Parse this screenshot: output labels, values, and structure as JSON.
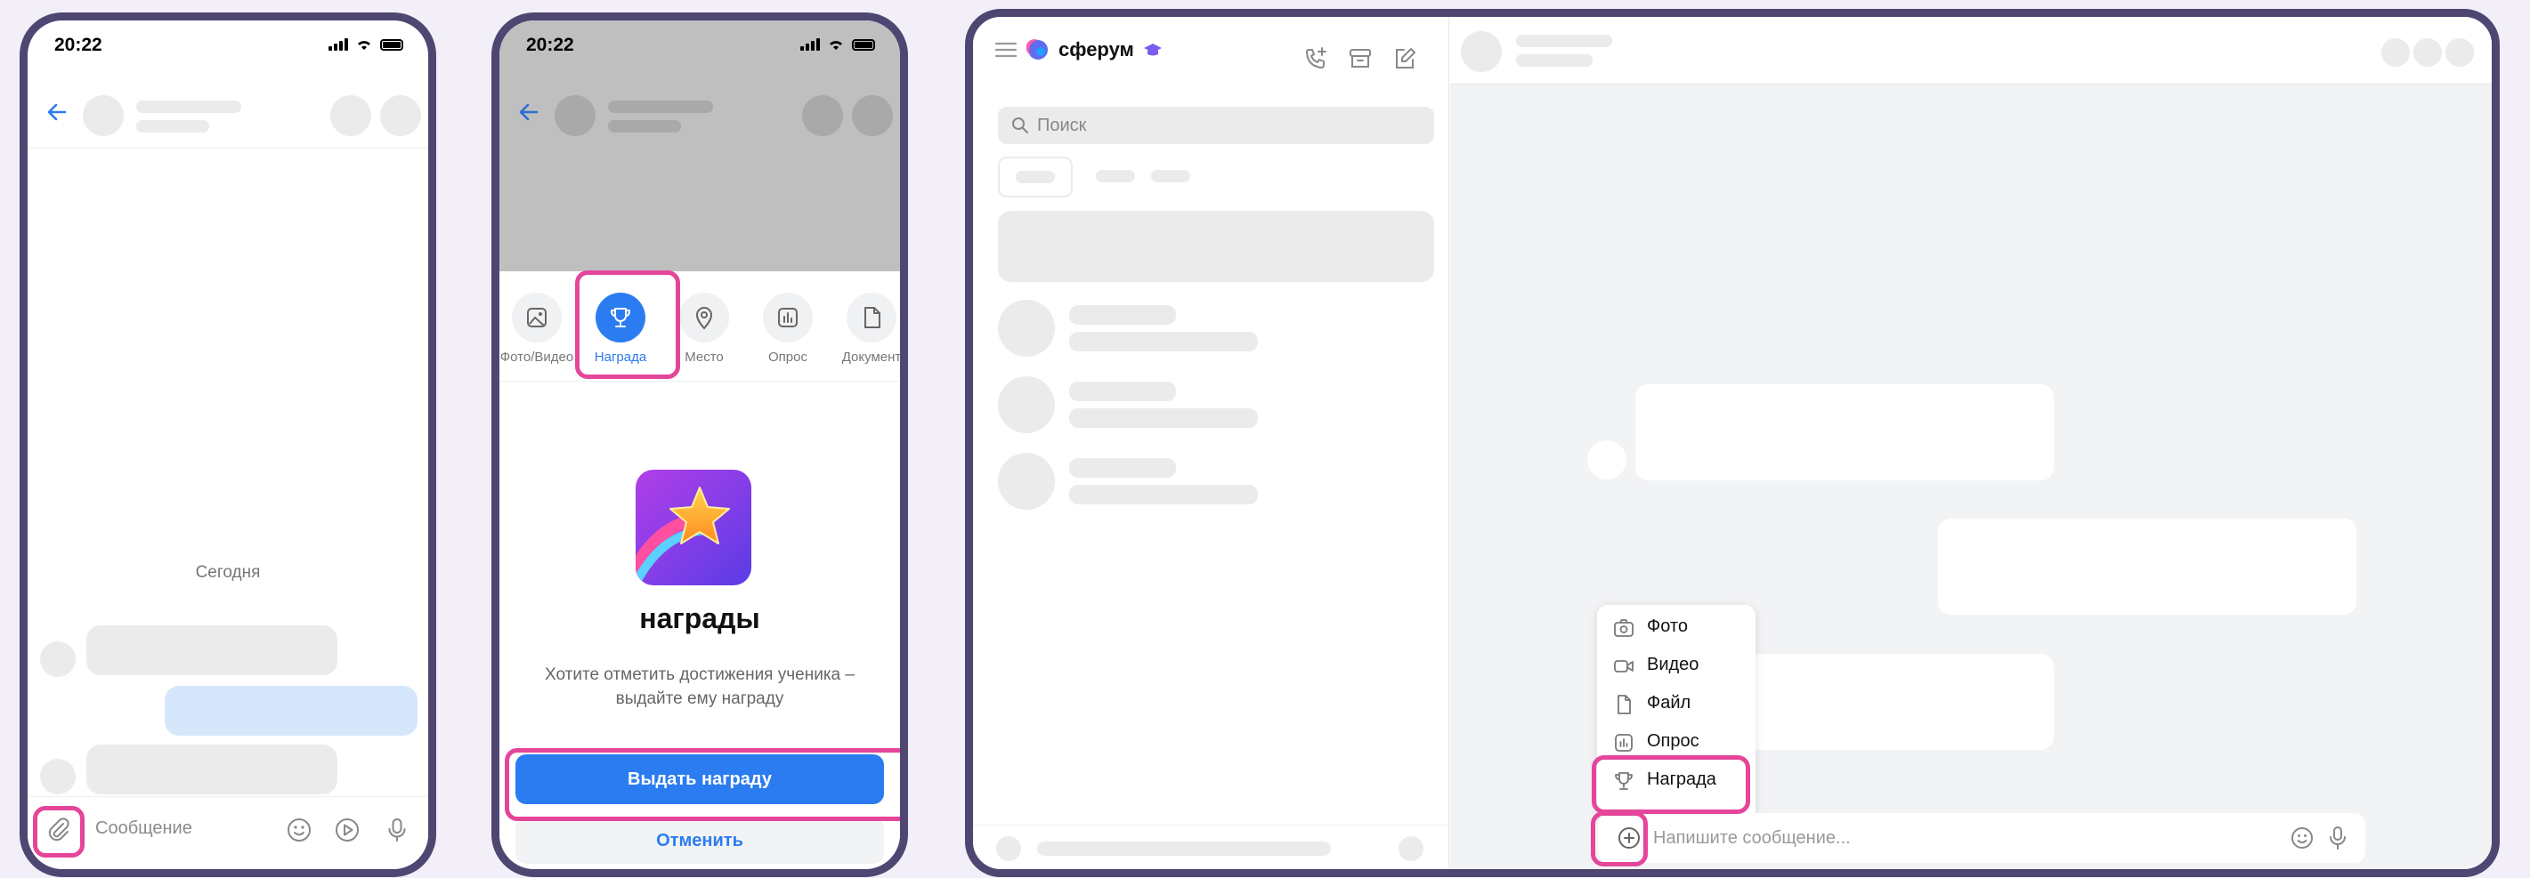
{
  "colors": {
    "frame": "#4f4672",
    "accent": "#2b7cf0",
    "highlight": "#e5459a",
    "background": "#f2eff8"
  },
  "phone1": {
    "time": "20:22",
    "date_divider": "Сегодня",
    "input_placeholder": "Сообщение",
    "icons": [
      "back-arrow-icon",
      "paperclip-icon",
      "emoji-icon",
      "play-icon",
      "microphone-icon"
    ]
  },
  "phone2": {
    "time": "20:22",
    "attach_items": [
      {
        "label": "Фото/Видео",
        "icon": "photo-icon"
      },
      {
        "label": "Награда",
        "icon": "trophy-icon",
        "selected": true
      },
      {
        "label": "Место",
        "icon": "location-icon"
      },
      {
        "label": "Опрос",
        "icon": "poll-icon"
      },
      {
        "label": "Документ",
        "icon": "document-icon"
      }
    ],
    "award_title": "награды",
    "award_description": "Хотите отметить достижения ученика – выдайте ему награду",
    "primary_button": "Выдать награду",
    "secondary_button": "Отменить"
  },
  "desktop": {
    "brand": "сферум",
    "search_placeholder": "Поиск",
    "message_placeholder": "Напишите сообщение...",
    "attach_menu": [
      {
        "label": "Фото",
        "icon": "camera-icon"
      },
      {
        "label": "Видео",
        "icon": "video-icon"
      },
      {
        "label": "Файл",
        "icon": "file-icon"
      },
      {
        "label": "Опрос",
        "icon": "poll-icon"
      },
      {
        "label": "Награда",
        "icon": "trophy-icon",
        "highlighted": true
      }
    ]
  }
}
